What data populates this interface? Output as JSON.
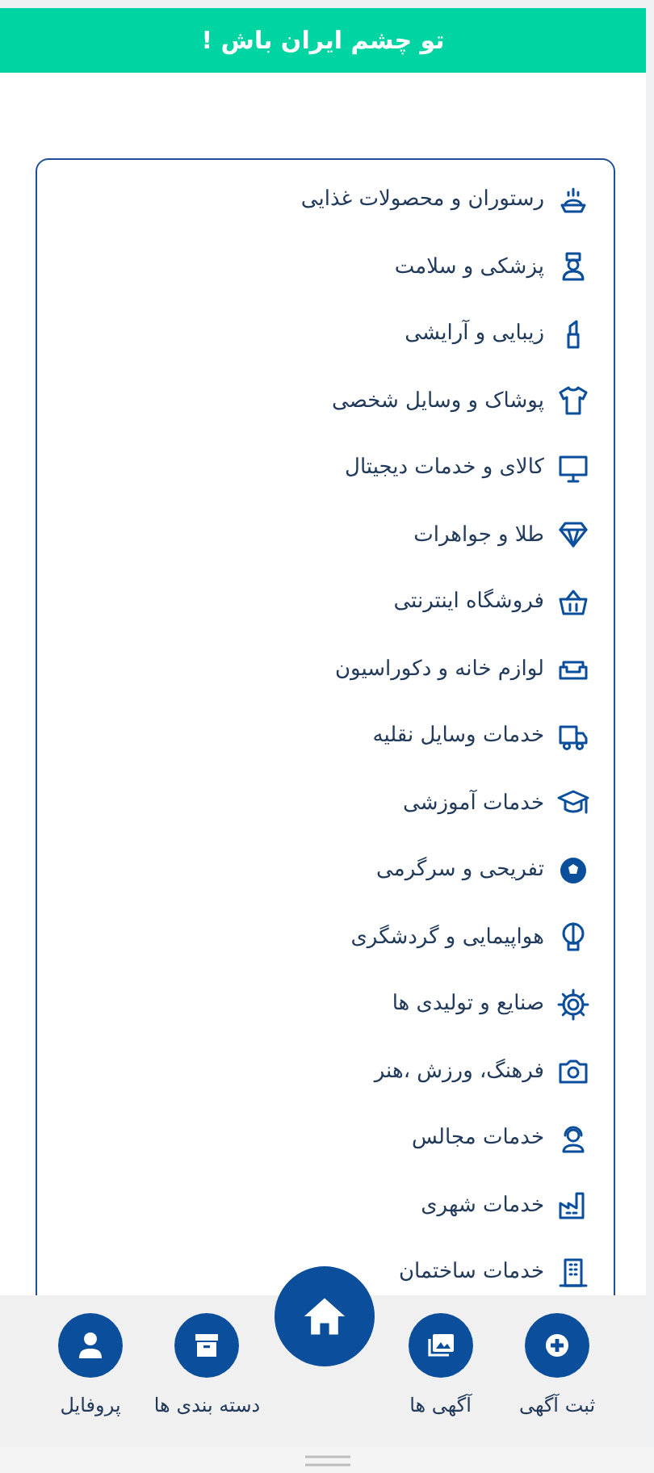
{
  "header": {
    "title": "تو چشم ایران باش !"
  },
  "categories": [
    {
      "label": "رستوران و محصولات غذایی"
    },
    {
      "label": "پزشکی و سلامت"
    },
    {
      "label": "زیبایی و آرایشی"
    },
    {
      "label": "پوشاک و وسایل شخصی"
    },
    {
      "label": "کالای و خدمات دیجیتال"
    },
    {
      "label": "طلا و جواهرات"
    },
    {
      "label": "فروشگاه اینترنتی"
    },
    {
      "label": "لوازم خانه و دکوراسیون"
    },
    {
      "label": "خدمات وسایل نقلیه"
    },
    {
      "label": "خدمات آموزشی"
    },
    {
      "label": "تفریحی و سرگرمی"
    },
    {
      "label": "هواپیمایی و گردشگری"
    },
    {
      "label": "صنایع و تولیدی ها"
    },
    {
      "label": "فرهنگ، ورزش ،هنر"
    },
    {
      "label": "خدمات مجالس"
    },
    {
      "label": "خدمات شهری"
    },
    {
      "label": "خدمات ساختمان"
    }
  ],
  "bottom_nav": [
    {
      "kind": "tab",
      "label": "ثبت آگهی"
    },
    {
      "kind": "tab",
      "label": "آگهی ها"
    },
    {
      "kind": "home"
    },
    {
      "kind": "tab",
      "label": "دسته بندی ها"
    },
    {
      "kind": "tab",
      "label": "پروفایل"
    }
  ]
}
